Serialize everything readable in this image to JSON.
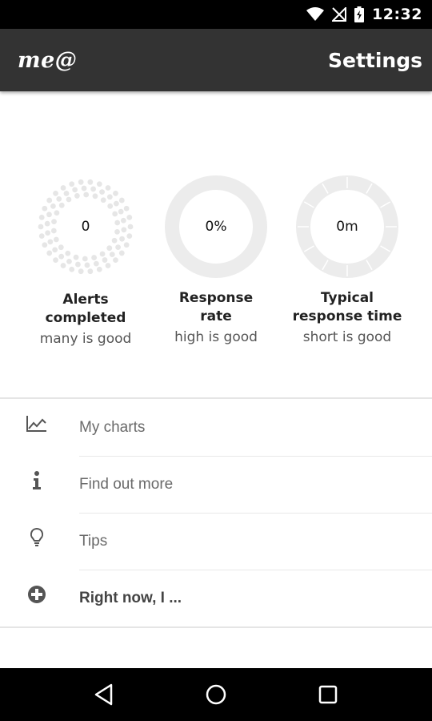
{
  "status_bar": {
    "time": "12:32",
    "icons": [
      "wifi-icon",
      "no-signal-icon",
      "battery-charging-icon"
    ]
  },
  "app_bar": {
    "logo": "me@",
    "settings_label": "Settings"
  },
  "stats": [
    {
      "value": "0",
      "title_line1": "Alerts",
      "title_line2": "completed",
      "subtitle": "many is good",
      "icon": "dotted-ring-icon"
    },
    {
      "value": "0%",
      "title_line1": "Response",
      "title_line2": "rate",
      "subtitle": "high is good",
      "icon": "ring-icon"
    },
    {
      "value": "0m",
      "title_line1": "Typical",
      "title_line2": "response time",
      "subtitle": "short is good",
      "icon": "clock-ring-icon"
    }
  ],
  "menu": {
    "items": [
      {
        "label": "My charts",
        "icon": "chart-icon"
      },
      {
        "label": "Find out more",
        "icon": "info-icon"
      },
      {
        "label": "Tips",
        "icon": "lightbulb-icon"
      },
      {
        "label": "Right now, I ...",
        "icon": "plus-circle-icon"
      }
    ]
  },
  "nav_bar": {
    "icons": [
      "back-icon",
      "home-icon",
      "recents-icon"
    ]
  },
  "colors": {
    "app_bar": "#333333",
    "gauge_ring": "#ececec",
    "divider": "#e5e5e5"
  }
}
